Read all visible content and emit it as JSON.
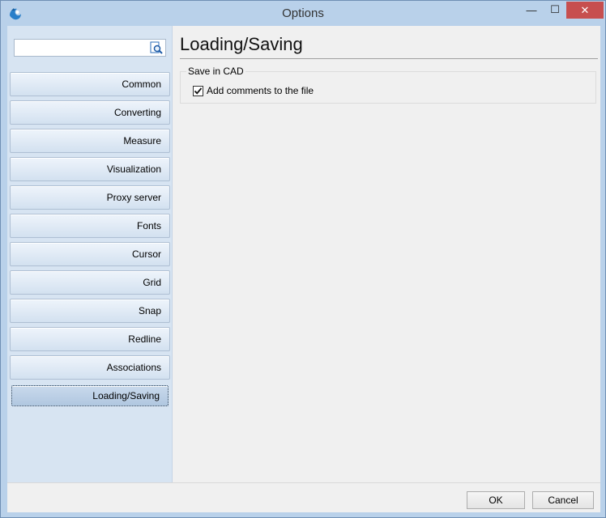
{
  "window": {
    "title": "Options",
    "minimize_glyph": "—",
    "maximize_glyph": "☐",
    "close_glyph": "✕"
  },
  "sidebar": {
    "search": {
      "value": "",
      "placeholder": ""
    },
    "items": [
      {
        "label": "Common"
      },
      {
        "label": "Converting"
      },
      {
        "label": "Measure"
      },
      {
        "label": "Visualization"
      },
      {
        "label": "Proxy server"
      },
      {
        "label": "Fonts"
      },
      {
        "label": "Cursor"
      },
      {
        "label": "Grid"
      },
      {
        "label": "Snap"
      },
      {
        "label": "Redline"
      },
      {
        "label": "Associations"
      },
      {
        "label": "Loading/Saving",
        "active": true
      }
    ]
  },
  "main": {
    "page_title": "Loading/Saving",
    "group": {
      "legend": "Save in CAD",
      "checkbox": {
        "label": "Add comments to the file",
        "checked": true,
        "glyph": "✔"
      }
    }
  },
  "footer": {
    "ok_label": "OK",
    "cancel_label": "Cancel"
  },
  "colors": {
    "frame": "#b9d1ea",
    "sidebar_bg": "#d7e4f2",
    "close_button": "#c74f4f",
    "panel_bg": "#f0f0f0"
  },
  "icons": [
    "app-icon",
    "search-icon",
    "minimize-icon",
    "maximize-icon",
    "close-icon",
    "checkmark-icon"
  ]
}
